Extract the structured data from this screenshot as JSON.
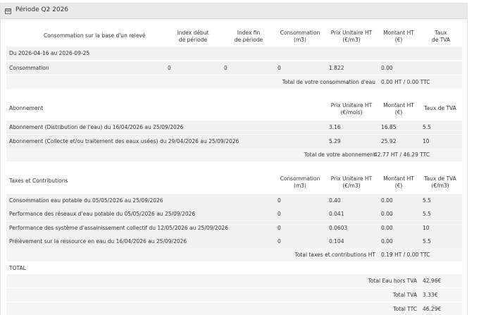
{
  "header": {
    "title": "Période Q2 2026"
  },
  "consumption": {
    "headers": {
      "label": "Consommation sur la base d'un relevé",
      "index_debut": [
        "Index début",
        "de période"
      ],
      "index_fin": [
        "Index fin",
        "de période"
      ],
      "consommation": [
        "Consommation",
        "(m3)"
      ],
      "prix": [
        "Prix Unitaire HT",
        "(€/m3)"
      ],
      "montant": [
        "Montant HT",
        "(€)"
      ],
      "taux": [
        "Taux",
        "de TVA"
      ]
    },
    "period": "Du 2026-04-16 au 2026-09-25",
    "row": {
      "label": "Consommation",
      "index_debut": "0",
      "index_fin": "0",
      "consommation": "0",
      "prix": "1.822",
      "montant": "0.00",
      "taux": ""
    },
    "total_label": "Total de votre consommation d'eau",
    "total_value": "0.00 HT / 0.00 TTC"
  },
  "abonnement": {
    "headers": {
      "label": "Abonnement",
      "prix": [
        "Prix Unitaire HT",
        "(€/mois)"
      ],
      "montant": [
        "Montant HT",
        "(€)"
      ],
      "taux": [
        "Taux de TVA"
      ]
    },
    "rows": [
      {
        "label": "Abonnement (Distribution de l'eau) du 16/04/2026 au 25/09/2026",
        "prix": "3.16",
        "montant": "16.85",
        "taux": "5.5"
      },
      {
        "label": "Abonnement (Collecte et/ou traitement des eaux usées) du 29/04/2026 au 25/09/2026",
        "prix": "5.29",
        "montant": "25.92",
        "taux": "10"
      }
    ],
    "total_label": "Total de votre abonnement",
    "total_value": "42.77 HT / 46.29 TTC"
  },
  "taxes": {
    "headers": {
      "label": "Taxes et Contributions",
      "consommation": [
        "Consommation",
        "(m3)"
      ],
      "prix": [
        "Prix Unitaire HT",
        "(€/m3)"
      ],
      "montant": [
        "Montant HT",
        "(€)"
      ],
      "taux": [
        "Taux de TVA",
        "(€/m3)"
      ]
    },
    "rows": [
      {
        "label": "Consommation eau potable du 05/05/2026 au 25/09/2026",
        "consommation": "0",
        "prix": "0.40",
        "montant": "0.00",
        "taux": "5.5"
      },
      {
        "label": "Performance des réseaux d'eau potable du 05/05/2026 au 25/09/2026",
        "consommation": "0",
        "prix": "0.041",
        "montant": "0.00",
        "taux": "5.5"
      },
      {
        "label": "Performance des système d'assainissement collectif du 12/05/2026 au 25/09/2026",
        "consommation": "0",
        "prix": "0.0603",
        "montant": "0.00",
        "taux": "10"
      },
      {
        "label": "Prélèvement sur la ressource en eau du 16/04/2026 au 25/09/2026",
        "consommation": "0",
        "prix": "0.104",
        "montant": "0.00",
        "taux": "5.5"
      }
    ],
    "total_label": "Total taxes et contributions HT",
    "total_value": "0.19 HT / 0.00 TTC"
  },
  "total": {
    "heading": "TOTAL",
    "rows": [
      {
        "label": "Total Eau hors TVA",
        "value": "42.96€"
      },
      {
        "label": "Total TVA",
        "value": "3.33€"
      },
      {
        "label": "Total TTC",
        "value": "46.29€"
      }
    ]
  }
}
